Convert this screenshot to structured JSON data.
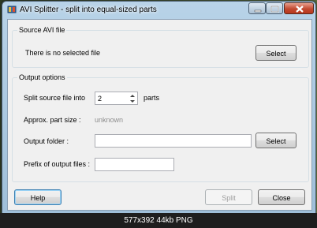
{
  "window": {
    "title": "AVI Splitter - split into equal-sized parts"
  },
  "source_group": {
    "legend": "Source AVI file",
    "status_text": "There is no selected file",
    "select_label": "Select"
  },
  "output_group": {
    "legend": "Output options",
    "split_label": "Split source file into",
    "parts_value": "2",
    "parts_suffix": "parts",
    "part_size_label": "Approx. part size :",
    "part_size_value": "unknown",
    "folder_label": "Output folder :",
    "folder_value": "",
    "folder_select_label": "Select",
    "prefix_label": "Prefix of output files :",
    "prefix_value": ""
  },
  "footer": {
    "help_label": "Help",
    "split_label": "Split",
    "close_label": "Close"
  },
  "image_info": {
    "caption": "577x392 44kb PNG"
  },
  "icons": {
    "app": "avi-splitter-app-icon",
    "minimize": "minimize-icon",
    "maximize": "maximize-icon",
    "close": "close-icon",
    "spin_up": "chevron-up-icon",
    "spin_down": "chevron-down-icon"
  }
}
